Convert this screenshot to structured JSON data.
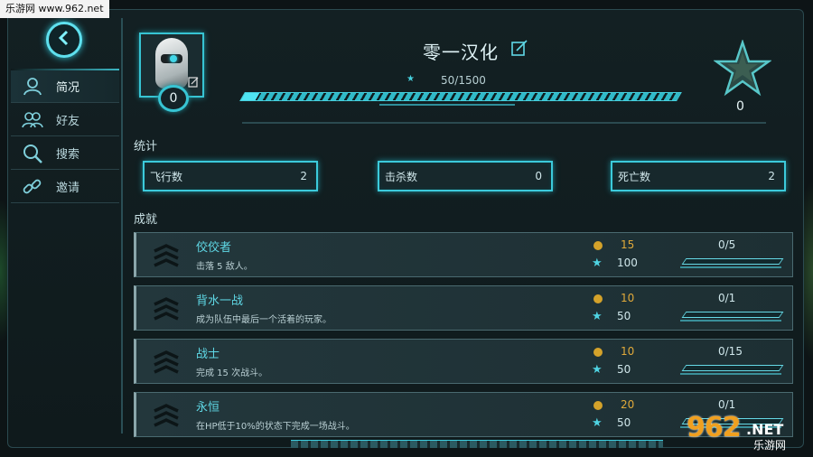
{
  "watermark": "乐游网 www.962.net",
  "sidebar": {
    "back_icon": "chevron-left-icon",
    "items": [
      {
        "label": "简况",
        "icon": "user-icon"
      },
      {
        "label": "好友",
        "icon": "users-icon"
      },
      {
        "label": "搜索",
        "icon": "search-icon"
      },
      {
        "label": "邀请",
        "icon": "link-icon"
      }
    ]
  },
  "profile": {
    "name": "零一汉化",
    "level": "0",
    "xp_text": "50/1500",
    "xp_progress": 0.033,
    "rank_value": "0"
  },
  "stats": {
    "title": "统计",
    "items": [
      {
        "label": "飞行数",
        "value": "2"
      },
      {
        "label": "击杀数",
        "value": "0"
      },
      {
        "label": "死亡数",
        "value": "2"
      }
    ]
  },
  "achievements": {
    "title": "成就",
    "items": [
      {
        "title": "佼佼者",
        "desc": "击落 5 敌人。",
        "coins": "15",
        "stars": "100",
        "progress": "0/5",
        "fraction": 0.0
      },
      {
        "title": "背水一战",
        "desc": "成为队伍中最后一个活着的玩家。",
        "coins": "10",
        "stars": "50",
        "progress": "0/1",
        "fraction": 0.0
      },
      {
        "title": "战士",
        "desc": "完成 15 次战斗。",
        "coins": "10",
        "stars": "50",
        "progress": "0/15",
        "fraction": 0.0
      },
      {
        "title": "永恒",
        "desc": "在HP低于10%的状态下完成一场战斗。",
        "coins": "20",
        "stars": "50",
        "progress": "0/1",
        "fraction": 0.0
      }
    ]
  },
  "logo": {
    "num": "962",
    "net": ".NET",
    "cn": "乐游网"
  },
  "colors": {
    "accent": "#3ccadb",
    "coin": "#d4a22a",
    "title": "#5fd8e6"
  }
}
